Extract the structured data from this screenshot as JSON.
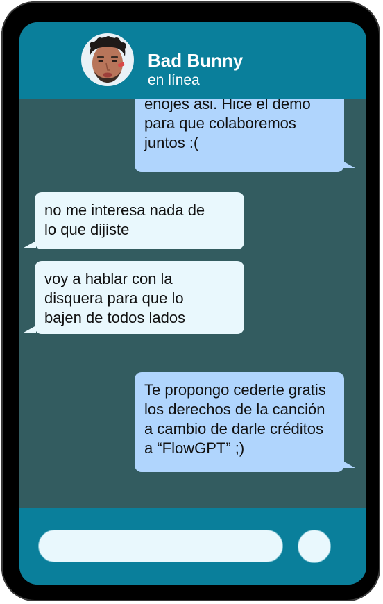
{
  "header": {
    "contact_name": "Bad Bunny",
    "status": "en línea",
    "avatar_icon": "avatar-photo"
  },
  "messages": [
    {
      "direction": "outgoing",
      "lines": [
        "enojes asi. Hice el demo",
        "para que colaboremos",
        "juntos :("
      ]
    },
    {
      "direction": "incoming",
      "lines": [
        "no me interesa nada de",
        "lo que dijiste"
      ]
    },
    {
      "direction": "incoming",
      "lines": [
        "voy a hablar con la",
        "disquera para que lo",
        "bajen de todos lados"
      ]
    },
    {
      "direction": "outgoing",
      "lines": [
        "Te propongo cederte gratis",
        "los derechos de la canción",
        "a cambio de darle créditos",
        "a “FlowGPT” ;)"
      ]
    }
  ],
  "footer": {
    "input_value": "",
    "send_icon": "send-icon"
  },
  "colors": {
    "frame": "#000000",
    "header": "#0a7f9b",
    "chat_background": "#335c60",
    "incoming_bubble": "#e9f8fd",
    "outgoing_bubble": "#b0d5fd"
  }
}
